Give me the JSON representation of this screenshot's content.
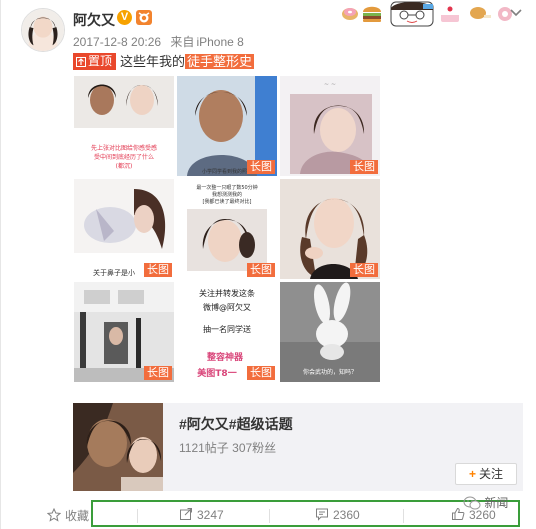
{
  "user": {
    "name": "阿欠又",
    "verified_icon": "v-badge-icon",
    "level_icon": "member-badge-icon"
  },
  "meta": {
    "date": "2017-12-8 20:26",
    "source_prefix": "来自",
    "source": "iPhone 8"
  },
  "post": {
    "pin_label": "置顶",
    "text": "这些年我的",
    "highlight": "徒手整形史"
  },
  "images": [
    {
      "caption": "先上张对比图给你感受感受中间到底经历了什么(都沉)",
      "long": false
    },
    {
      "caption": "",
      "long": true
    },
    {
      "caption": "",
      "long": true
    },
    {
      "caption": "关于鼻子是小",
      "long": true
    },
    {
      "caption": "最一次整一只眼了数50分钟 — 我想测测我的 [我都已读了最终对比]",
      "long": true
    },
    {
      "caption": "",
      "long": true
    },
    {
      "caption": "",
      "long": true
    },
    {
      "caption": "关注并转发这条 微博@阿欠又 抽一名同学送 整容神器 美图T8一",
      "long": true
    },
    {
      "caption": "你会武功的，知吗？",
      "long": false
    }
  ],
  "long_tag": "长图",
  "topic": {
    "title": "#阿欠又#超级话题",
    "stats": "1121帖子 307粉丝",
    "follow_plus": "+",
    "follow_label": "关注"
  },
  "actions": {
    "favorite_label": "收藏",
    "repost_count": "3247",
    "comment_count": "2360",
    "like_count": "3260"
  },
  "watermark": "新闻",
  "colors": {
    "accent_orange": "#f26d3d",
    "pin_red": "#e9482c",
    "highlight_box": "#3a9d3a",
    "follow_orange": "#ff8200"
  }
}
